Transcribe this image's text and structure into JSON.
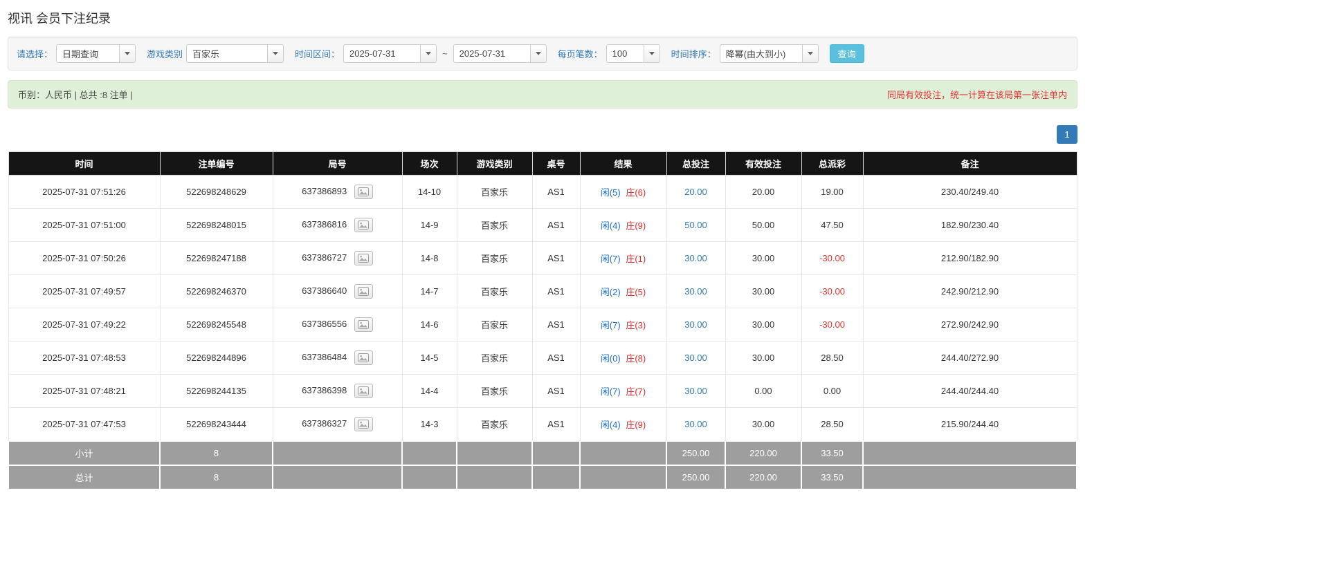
{
  "colors": {
    "accent": "#337ab7",
    "search_button": "#5bc0de",
    "search_button_border": "#46b8da",
    "summary_bg": "#dff0d8",
    "summary_border": "#d6e9c6",
    "summary_text": "#4a4a4a",
    "alert_text": "#e53333",
    "player_blue": "#1a6fc4",
    "banker_red": "#d9302c",
    "negative_red": "#e53333",
    "header_bg": "#151515",
    "footer_bg": "#9e9e9e",
    "link": "#337ab7"
  },
  "page": {
    "title": "视讯 会员下注纪录"
  },
  "filters": {
    "select_label": "请选择：",
    "select_value": "日期查询",
    "game_type_label": "游戏类别",
    "game_type_value": "百家乐",
    "time_range_label": "时间区间：",
    "time_from": "2025-07-31",
    "tilde": "~",
    "time_to": "2025-07-31",
    "page_size_label": "每页笔数：",
    "page_size_value": "100",
    "sort_label": "时间排序：",
    "sort_value": "降幂(由大到小)",
    "search_button": "查询"
  },
  "summary": {
    "left": "币别：人民币 | 总共 :8 注单 |",
    "right": "同局有效投注，统一计算在该局第一张注单内"
  },
  "pagination": {
    "current_page": "1"
  },
  "table": {
    "headers": [
      "时间",
      "注单编号",
      "局号",
      "场次",
      "游戏类别",
      "桌号",
      "结果",
      "总投注",
      "有效投注",
      "总派彩",
      "备注"
    ],
    "rows": [
      {
        "time": "2025-07-31 07:51:26",
        "bet_id": "522698248629",
        "round_id": "637386893",
        "session": "14-10",
        "game": "百家乐",
        "table_no": "AS1",
        "result_player": "闲(5)",
        "result_banker": "庄(6)",
        "total_bet": "20.00",
        "valid_bet": "20.00",
        "payout": "19.00",
        "note": "230.40/249.40"
      },
      {
        "time": "2025-07-31 07:51:00",
        "bet_id": "522698248015",
        "round_id": "637386816",
        "session": "14-9",
        "game": "百家乐",
        "table_no": "AS1",
        "result_player": "闲(4)",
        "result_banker": "庄(9)",
        "total_bet": "50.00",
        "valid_bet": "50.00",
        "payout": "47.50",
        "note": "182.90/230.40"
      },
      {
        "time": "2025-07-31 07:50:26",
        "bet_id": "522698247188",
        "round_id": "637386727",
        "session": "14-8",
        "game": "百家乐",
        "table_no": "AS1",
        "result_player": "闲(7)",
        "result_banker": "庄(1)",
        "total_bet": "30.00",
        "valid_bet": "30.00",
        "payout": "-30.00",
        "note": "212.90/182.90"
      },
      {
        "time": "2025-07-31 07:49:57",
        "bet_id": "522698246370",
        "round_id": "637386640",
        "session": "14-7",
        "game": "百家乐",
        "table_no": "AS1",
        "result_player": "闲(2)",
        "result_banker": "庄(5)",
        "total_bet": "30.00",
        "valid_bet": "30.00",
        "payout": "-30.00",
        "note": "242.90/212.90"
      },
      {
        "time": "2025-07-31 07:49:22",
        "bet_id": "522698245548",
        "round_id": "637386556",
        "session": "14-6",
        "game": "百家乐",
        "table_no": "AS1",
        "result_player": "闲(7)",
        "result_banker": "庄(3)",
        "total_bet": "30.00",
        "valid_bet": "30.00",
        "payout": "-30.00",
        "note": "272.90/242.90"
      },
      {
        "time": "2025-07-31 07:48:53",
        "bet_id": "522698244896",
        "round_id": "637386484",
        "session": "14-5",
        "game": "百家乐",
        "table_no": "AS1",
        "result_player": "闲(0)",
        "result_banker": "庄(8)",
        "total_bet": "30.00",
        "valid_bet": "30.00",
        "payout": "28.50",
        "note": "244.40/272.90"
      },
      {
        "time": "2025-07-31 07:48:21",
        "bet_id": "522698244135",
        "round_id": "637386398",
        "session": "14-4",
        "game": "百家乐",
        "table_no": "AS1",
        "result_player": "闲(7)",
        "result_banker": "庄(7)",
        "total_bet": "30.00",
        "valid_bet": "0.00",
        "payout": "0.00",
        "note": "244.40/244.40"
      },
      {
        "time": "2025-07-31 07:47:53",
        "bet_id": "522698243444",
        "round_id": "637386327",
        "session": "14-3",
        "game": "百家乐",
        "table_no": "AS1",
        "result_player": "闲(4)",
        "result_banker": "庄(9)",
        "total_bet": "30.00",
        "valid_bet": "30.00",
        "payout": "28.50",
        "note": "215.90/244.40"
      }
    ],
    "subtotal": {
      "label": "小计",
      "count": "8",
      "total_bet": "250.00",
      "valid_bet": "220.00",
      "payout": "33.50"
    },
    "total": {
      "label": "总计",
      "count": "8",
      "total_bet": "250.00",
      "valid_bet": "220.00",
      "payout": "33.50"
    }
  }
}
